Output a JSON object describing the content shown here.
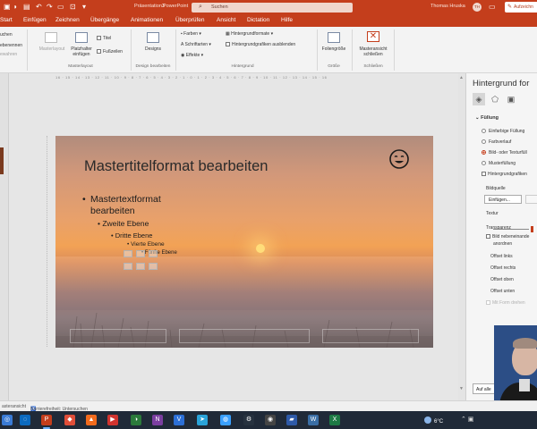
{
  "titlebar": {
    "filename": "Präsentation3",
    "app": "PowerPoint",
    "search_placeholder": "Suchen",
    "user": "Thomas Hruska",
    "user_initials": "TH",
    "share_label": "Aufzeichn"
  },
  "menu": {
    "tabs": [
      "Start",
      "Einfügen",
      "Zeichnen",
      "Übergänge",
      "Animationen",
      "Überprüfen",
      "Ansicht",
      "Dictation",
      "Hilfe"
    ]
  },
  "ribbon": {
    "left_items": [
      "uchen",
      "ebenennen",
      "ewahren"
    ],
    "masterlayout_btn": "Masterlayout",
    "placeholder_btn": "Platzhalter einfügen",
    "title_chk": "Titel",
    "footer_chk": "Fußzeilen",
    "group_masterlayout": "Masterlayout",
    "designs_btn": "Designs",
    "group_design": "Design bearbeiten",
    "colors": "Farben",
    "fonts": "Schriftarten",
    "effects": "Effekte",
    "bg_formats": "Hintergrundformate",
    "hide_bg_graphics": "Hintergrundgrafiken ausblenden",
    "group_background": "Hintergrund",
    "slide_size": "Foliengröße",
    "group_size": "Größe",
    "close_master": "Masteransicht schließen",
    "group_close": "Schließen"
  },
  "slide": {
    "title": "Mastertitelformat bearbeiten",
    "level1": "Mastertextformat bearbeiten",
    "level2": "Zweite Ebene",
    "level3": "Dritte Ebene",
    "level4": "Vierte Ebene",
    "level5": "Fünfte Ebene"
  },
  "ruler": {
    "marks": "16 · 15 · 14 · 13 · 12 · 11 · 10 · 9 · 8 · 7 · 6 · 5 · 4 · 3 · 2 · 1 · 0 · 1 · 2 · 3 · 4 · 5 · 6 · 7 · 8 · 9 · 10 · 11 · 12 · 13 · 14 · 15 · 16"
  },
  "pane": {
    "title": "Hintergrund for",
    "section_fill": "Füllung",
    "options": [
      "Einfarbige Füllung",
      "Farbverlauf",
      "Bild- oder Texturfüll",
      "Musterfüllung",
      "Hintergrundgrafiken"
    ],
    "selected_option": "Bild- oder Texturfüll",
    "image_source": "Bildquelle",
    "insert_btn": "Einfügen...",
    "texture": "Textur",
    "transparency": "Transparenz",
    "tile_line1": "Bild nebeneinande",
    "tile_line2": "anordnen",
    "offset_left": "Offset links",
    "offset_right": "Offset rechts",
    "offset_top": "Offset oben",
    "offset_bottom": "Offset unten",
    "rotate_with_shape": "Mit Form drehen",
    "apply_all": "Auf alle"
  },
  "status": {
    "view": "asteransicht",
    "accessibility": "Barrierefreiheit: Untersuchen"
  },
  "taskbar": {
    "weather": "6°C"
  },
  "colors": {
    "accent": "#c43e1c",
    "taskbar": "#202a38"
  }
}
